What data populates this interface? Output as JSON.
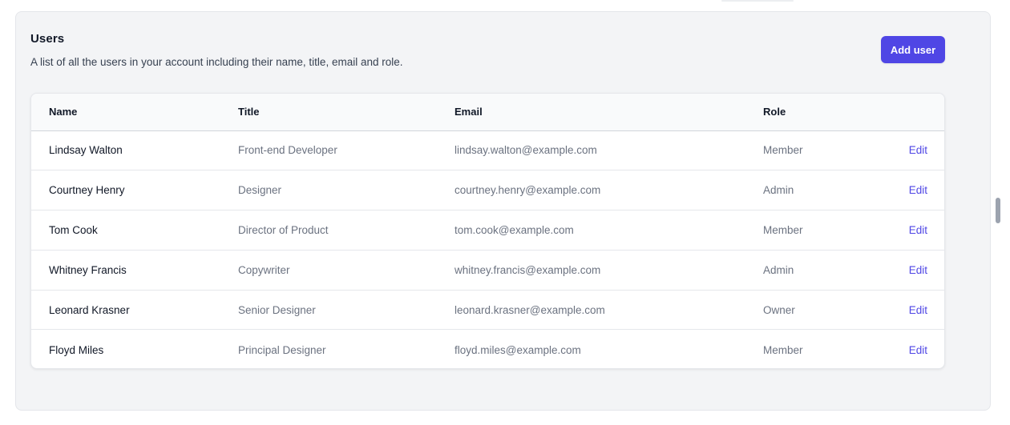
{
  "header": {
    "title": "Users",
    "description": "A list of all the users in your account including their name, title, email and role.",
    "add_button_label": "Add user"
  },
  "table": {
    "columns": [
      "Name",
      "Title",
      "Email",
      "Role"
    ],
    "edit_label": "Edit",
    "rows": [
      {
        "name": "Lindsay Walton",
        "title": "Front-end Developer",
        "email": "lindsay.walton@example.com",
        "role": "Member"
      },
      {
        "name": "Courtney Henry",
        "title": "Designer",
        "email": "courtney.henry@example.com",
        "role": "Admin"
      },
      {
        "name": "Tom Cook",
        "title": "Director of Product",
        "email": "tom.cook@example.com",
        "role": "Member"
      },
      {
        "name": "Whitney Francis",
        "title": "Copywriter",
        "email": "whitney.francis@example.com",
        "role": "Admin"
      },
      {
        "name": "Leonard Krasner",
        "title": "Senior Designer",
        "email": "leonard.krasner@example.com",
        "role": "Owner"
      },
      {
        "name": "Floyd Miles",
        "title": "Principal Designer",
        "email": "floyd.miles@example.com",
        "role": "Member"
      }
    ]
  },
  "colors": {
    "accent": "#4f46e5",
    "panel_bg": "#f3f4f6",
    "text_primary": "#111827",
    "text_secondary": "#6b7280"
  }
}
